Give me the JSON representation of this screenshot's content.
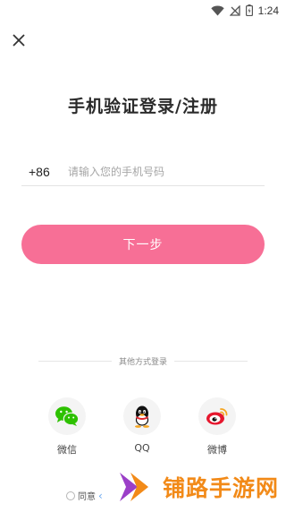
{
  "status_bar": {
    "time": "1:24"
  },
  "header": {
    "title": "手机验证登录/注册"
  },
  "phone": {
    "country_code": "+86",
    "placeholder": "请输入您的手机号码"
  },
  "next_button": {
    "label": "下一步"
  },
  "other_login": {
    "divider_text": "其他方式登录",
    "options": [
      {
        "label": "微信",
        "icon": "wechat-icon"
      },
      {
        "label": "QQ",
        "icon": "qq-icon"
      },
      {
        "label": "微博",
        "icon": "weibo-icon"
      }
    ]
  },
  "agreement": {
    "text": "同意"
  },
  "watermark": {
    "text": "铺路手游网"
  },
  "colors": {
    "accent": "#f76f96",
    "wechat": "#2dc100",
    "weibo": "#e6162d",
    "watermark": "#f28a18"
  }
}
